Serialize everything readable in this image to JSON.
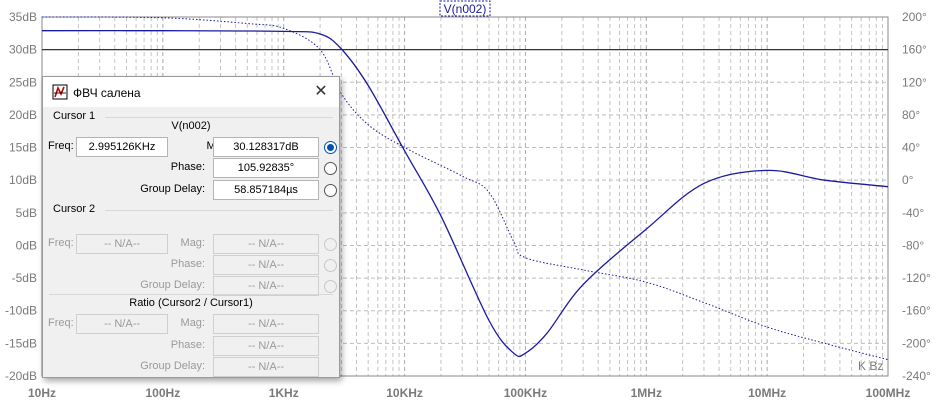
{
  "plot": {
    "trace_name": "V(n002)",
    "left_axis_labels": [
      "35dB",
      "30dB",
      "25dB",
      "20dB",
      "15dB",
      "10dB",
      "5dB",
      "0dB",
      "-5dB",
      "-10dB",
      "-15dB",
      "-20dB"
    ],
    "right_axis_labels": [
      "200°",
      "160°",
      "120°",
      "80°",
      "40°",
      "0°",
      "-40°",
      "-80°",
      "-120°",
      "-160°",
      "-200°",
      "-240°"
    ],
    "x_axis_labels": [
      "10Hz",
      "100Hz",
      "1KHz",
      "10KHz",
      "100KHz",
      "1MHz",
      "10MHz",
      "100MHz"
    ],
    "x_axis_scale": "log",
    "left_axis_range_db": [
      -20,
      35
    ],
    "right_axis_range_deg": [
      -240,
      200
    ],
    "x_range_hz": [
      10,
      100000000
    ],
    "trace_color": "#1a1aa0",
    "cursor_level_db": 30,
    "corner_label": "K Bz"
  },
  "chart_data": {
    "type": "line",
    "title": "V(n002)",
    "x_scale": "log",
    "xlim": [
      10,
      100000000
    ],
    "ylim": [
      -20,
      35
    ],
    "y2lim": [
      -240,
      200
    ],
    "grid": true,
    "series": [
      {
        "name": "V(n002)",
        "style": "solid",
        "axis": "left",
        "x": [
          10,
          100,
          1000,
          2000,
          3000,
          5000,
          10000,
          20000,
          50000,
          80000,
          100000,
          150000,
          300000,
          1000000,
          3000000,
          10000000,
          30000000,
          100000000
        ],
        "y": [
          32.9,
          32.9,
          32.8,
          32.4,
          30.1,
          24.5,
          14.5,
          4.5,
          -11.5,
          -16.5,
          -16.5,
          -13.5,
          -6,
          2.5,
          9.5,
          11.5,
          10,
          9
        ]
      },
      {
        "axis": "right",
        "style": "dotted",
        "x": [
          10,
          100,
          500,
          1000,
          2000,
          3000,
          5000,
          10000,
          30000,
          50000,
          80000,
          100000,
          300000,
          1000000,
          3000000,
          10000000,
          30000000,
          100000000
        ],
        "y": [
          200,
          199,
          192,
          186,
          160,
          106,
          68,
          40,
          5,
          -15,
          -75,
          -95,
          -110,
          -125,
          -150,
          -180,
          -200,
          -220
        ]
      }
    ]
  },
  "dialog": {
    "title": "ФВЧ салена",
    "cursor1": {
      "section_label": "Cursor 1",
      "trace_label": "V(n002)",
      "freq_label": "Freq:",
      "freq_value": "2.995126KHz",
      "mag_label": "Mag:",
      "mag_value": "30.128317dB",
      "phase_label": "Phase:",
      "phase_value": "105.92835°",
      "gd_label": "Group Delay:",
      "gd_value": "58.857184µs"
    },
    "cursor2": {
      "section_label": "Cursor 2",
      "freq_label": "Freq:",
      "freq_value": "-- N/A--",
      "mag_label": "Mag:",
      "mag_value": "-- N/A--",
      "phase_label": "Phase:",
      "phase_value": "-- N/A--",
      "gd_label": "Group Delay:",
      "gd_value": "-- N/A--"
    },
    "ratio": {
      "section_label": "Ratio (Cursor2 / Cursor1)",
      "freq_label": "Freq:",
      "freq_value": "-- N/A--",
      "mag_label": "Mag:",
      "mag_value": "-- N/A--",
      "phase_label": "Phase:",
      "phase_value": "-- N/A--",
      "gd_label": "Group Delay:",
      "gd_value": "-- N/A--"
    }
  }
}
